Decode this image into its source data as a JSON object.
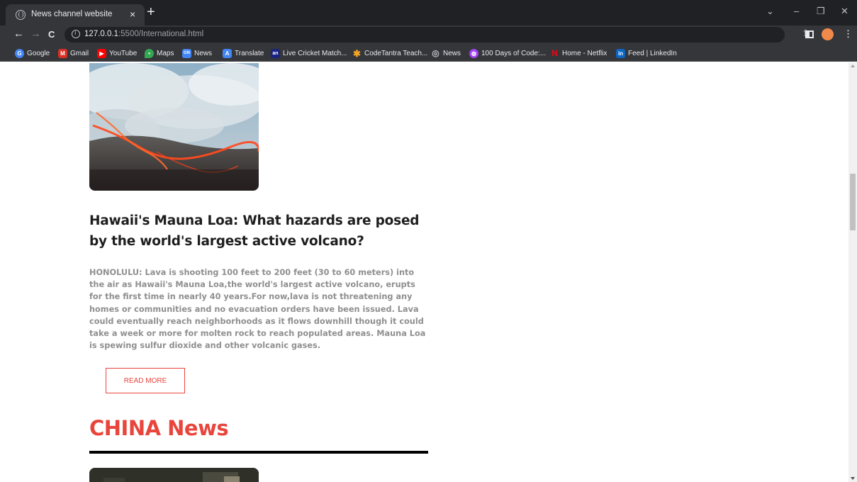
{
  "browser": {
    "tab_title": "News channel website",
    "tab_close": "×",
    "new_tab": "+",
    "url_host": "127.0.0.1",
    "url_rest": ":5500/International.html",
    "window_controls": {
      "chevron": "⌄",
      "minimize": "–",
      "restore": "❐",
      "close": "✕"
    },
    "toolbar_right": {
      "share": "⇪",
      "star": "☆",
      "menu": "⋮"
    },
    "nav": {
      "back": "←",
      "forward": "→",
      "reload": "C"
    }
  },
  "bookmarks": [
    {
      "label": "Google",
      "icon": "google-icon",
      "color": "#4285f4",
      "glyph": "G"
    },
    {
      "label": "Gmail",
      "icon": "gmail-icon",
      "color": "#d93025",
      "glyph": "M"
    },
    {
      "label": "YouTube",
      "icon": "youtube-icon",
      "color": "#ff0000",
      "glyph": "▶"
    },
    {
      "label": "Maps",
      "icon": "maps-icon",
      "color": "#34a853",
      "glyph": "•"
    },
    {
      "label": "News",
      "icon": "google-news-icon",
      "color": "#4285f4",
      "glyph": "GN"
    },
    {
      "label": "Translate",
      "icon": "translate-icon",
      "color": "#4285f4",
      "glyph": "A"
    },
    {
      "label": "Live Cricket Match...",
      "icon": "cricket-icon",
      "color": "#1a237e",
      "glyph": "an"
    },
    {
      "label": "CodeTantra Teach...",
      "icon": "codetantra-icon",
      "color": "#f5a623",
      "glyph": "✱"
    },
    {
      "label": "News",
      "icon": "globe-icon",
      "color": "#5f6368",
      "glyph": "◎"
    },
    {
      "label": "100 Days of Code:...",
      "icon": "course-icon",
      "color": "#a142f4",
      "glyph": "◍"
    },
    {
      "label": "Home - Netflix",
      "icon": "netflix-icon",
      "color": "#e50914",
      "glyph": "N"
    },
    {
      "label": "Feed | LinkedIn",
      "icon": "linkedin-icon",
      "color": "#0a66c2",
      "glyph": "in"
    }
  ],
  "article": {
    "title": "Hawaii's Mauna Loa: What hazards are posed by the world's largest active volcano?",
    "body": "HONOLULU: Lava is shooting 100 feet to 200 feet (30 to 60 meters) into the air as Hawaii's Mauna Loa,the world's largest active volcano, erupts for the first time in nearly 40 years.For now,lava is not threatening any homes or communities and no evacuation orders have been issued. Lava could eventually reach neighborhoods as it flows downhill though it could take a week or more for molten rock to reach populated areas. Mauna Loa is spewing sulfur dioxide and other volcanic gases.",
    "read_more": "READ MORE"
  },
  "section": {
    "title": "CHINA News"
  },
  "colors": {
    "accent": "#e8453c",
    "heading": "#1e1e1e",
    "body_text": "#8f8f8f"
  }
}
